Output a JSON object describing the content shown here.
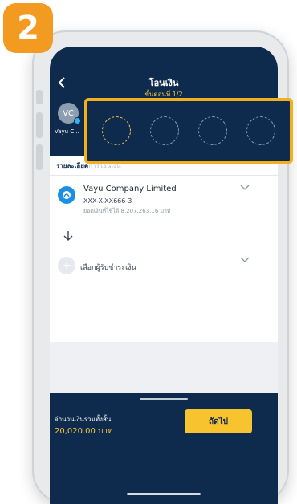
{
  "step_badge": "2",
  "header": {
    "back_icon": "chevron-left-icon",
    "title": "โอนเงิน",
    "step": "ขั้นตอนที่ 1/2",
    "avatar_initials": "VC",
    "avatar_name": "Vayu C..."
  },
  "recent_receivers": {
    "slots": 4
  },
  "details": {
    "section_label": "รายละเอียด",
    "section_label_faded": "การโอนเงิน"
  },
  "account": {
    "name": "Vayu Company Limited",
    "number": "XXX-X-XX666-3",
    "balance": "ยอดเงินที่ใช้ได้ 8,207,263.16 บาท"
  },
  "payer": {
    "label": "เลือกผู้รับชำระเงิน"
  },
  "footer": {
    "total_label": "จำนวนเงินรวมทั้งสิ้น",
    "total_value": "20,020.00 บาท",
    "next_label": "ถัดไป"
  },
  "colors": {
    "navy": "#0e2b4d",
    "accent_yellow": "#f7c32e",
    "badge_orange": "#f39a21"
  }
}
